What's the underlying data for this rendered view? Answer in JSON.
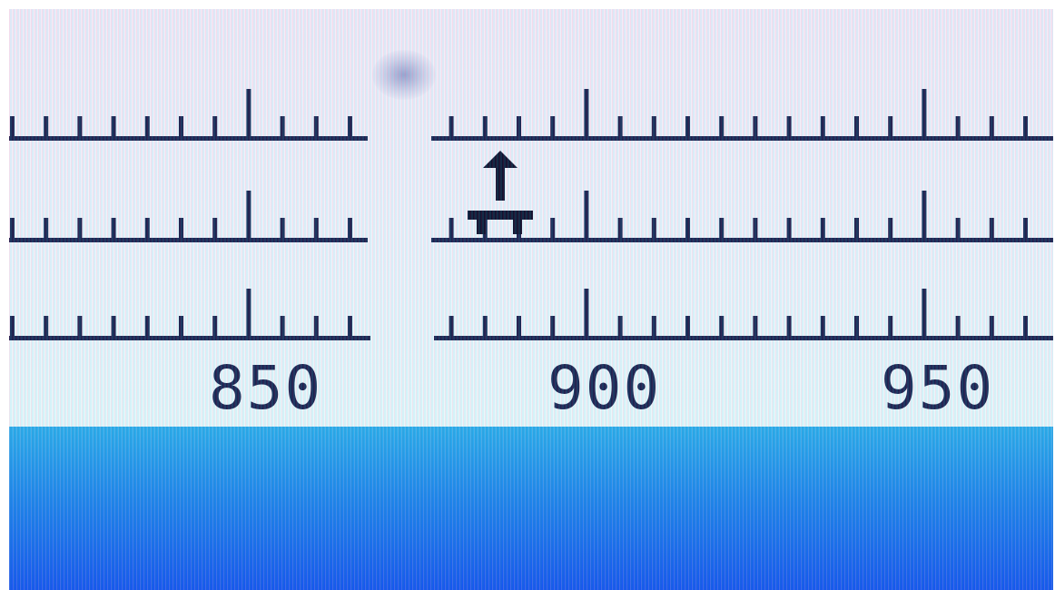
{
  "scale": {
    "labels": [
      "850",
      "900",
      "950"
    ]
  },
  "marker": {
    "icon": "up-arrow-marker-icon"
  },
  "colors": {
    "ink": "#1b2450",
    "background": "#eef4fb",
    "panel_top": "#2fb3f0",
    "panel_bottom": "#1654f2"
  }
}
